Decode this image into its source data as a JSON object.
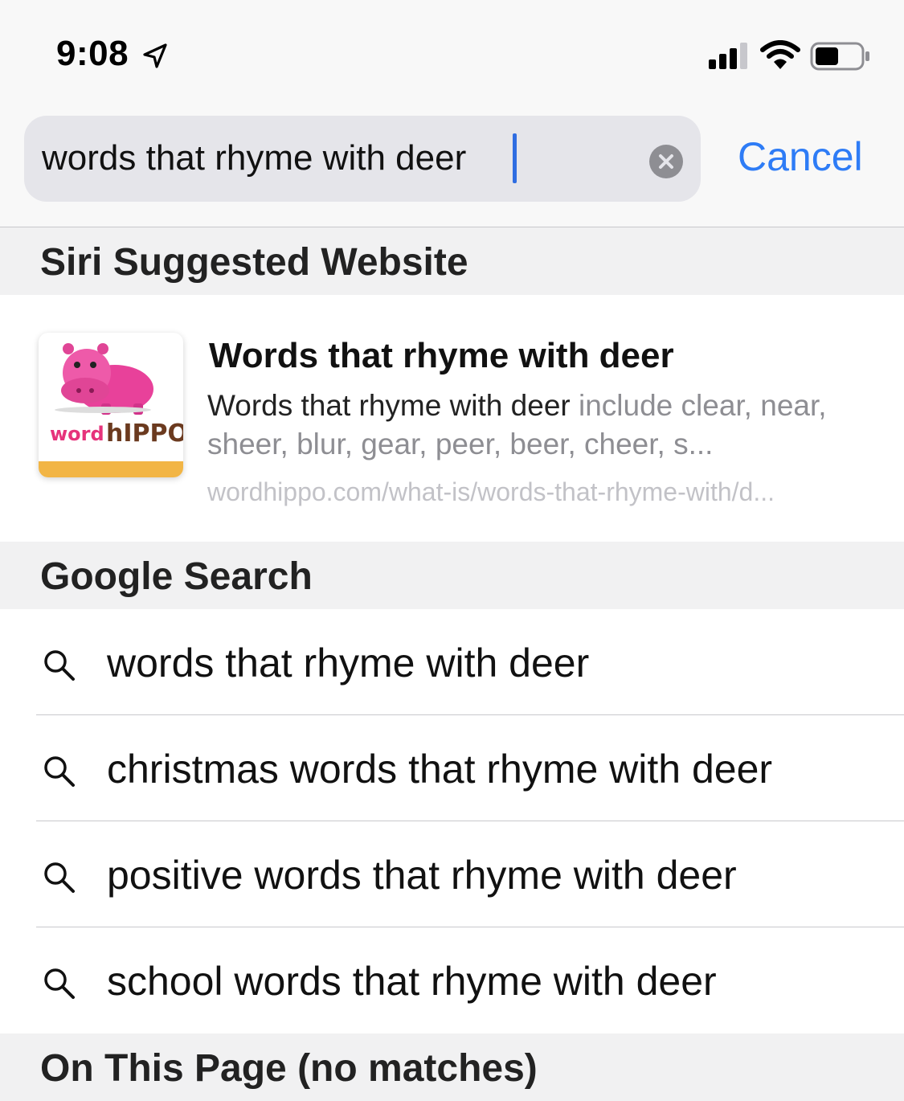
{
  "status_bar": {
    "time": "9:08",
    "icons": [
      "location-arrow-icon",
      "cellular-signal-icon",
      "wifi-icon",
      "battery-icon"
    ]
  },
  "search": {
    "query": "words that rhyme with deer",
    "cancel_label": "Cancel"
  },
  "siri_section": {
    "header": "Siri Suggested Website",
    "result": {
      "title": "Words that rhyme with deer",
      "desc_highlight": "Words that rhyme with deer",
      "desc_rest": " include clear, near, sheer, blur, gear, peer, beer, cheer, s...",
      "url": "wordhippo.com/what-is/words-that-rhyme-with/d...",
      "logo_word": "word",
      "logo_hippo": "hIPPO"
    }
  },
  "google_section": {
    "header": "Google Search",
    "suggestions": [
      "words that rhyme with deer",
      "christmas words that rhyme with deer",
      "positive words that rhyme with deer",
      "school words that rhyme with deer"
    ]
  },
  "on_page_section": {
    "header": "On This Page (no matches)"
  },
  "colors": {
    "accent": "#2e7cf6",
    "caret": "#2f6de1",
    "logo_pink": "#e6337b",
    "logo_bar": "#f2b545"
  }
}
